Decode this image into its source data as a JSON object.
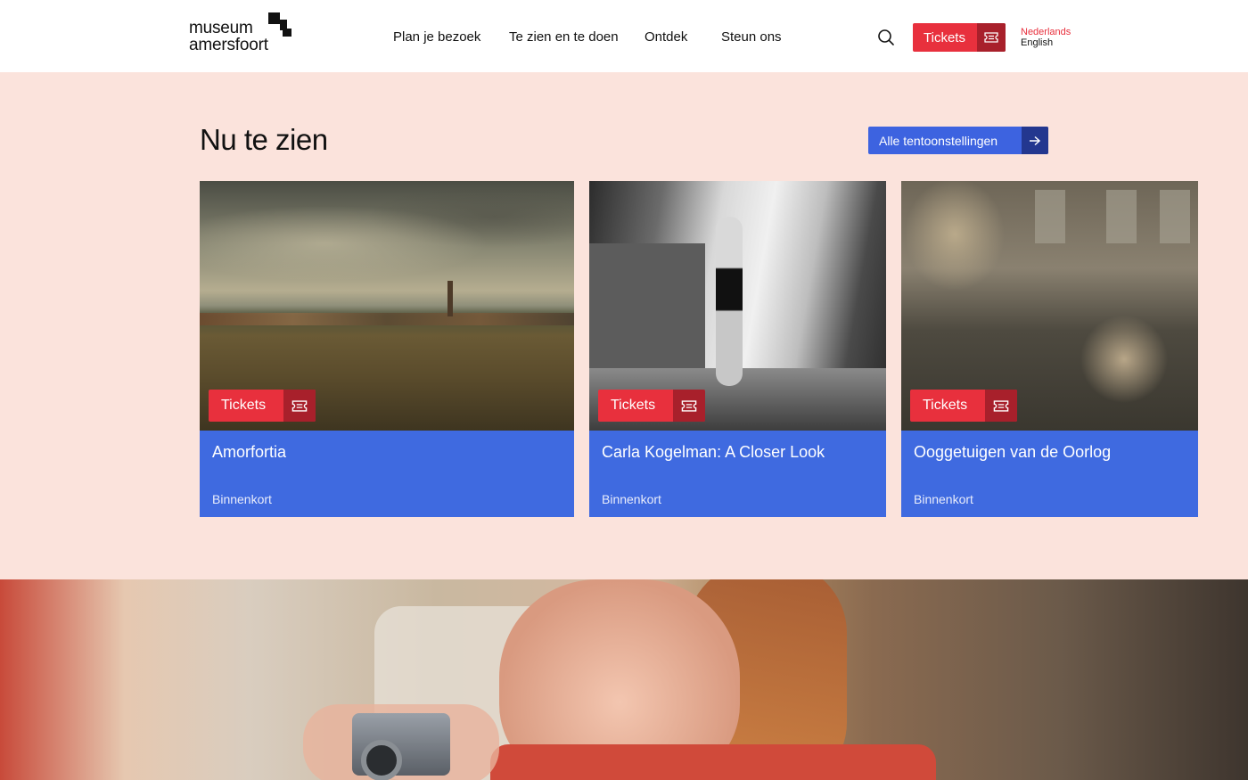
{
  "header": {
    "logo": {
      "line1": "museum",
      "line2": "amersfoort"
    },
    "nav": [
      {
        "label": "Plan je bezoek"
      },
      {
        "label": "Te zien en te doen"
      },
      {
        "label": "Ontdek"
      },
      {
        "label": "Steun ons"
      }
    ],
    "search_icon": "search-icon",
    "tickets_label": "Tickets",
    "ticket_icon": "ticket-icon",
    "languages": {
      "current": "Nederlands",
      "other": "English"
    }
  },
  "section": {
    "title": "Nu te zien",
    "all_button_label": "Alle tentoonstellingen",
    "all_button_icon": "arrow-right-icon"
  },
  "cards": [
    {
      "title": "Amorfortia",
      "status": "Binnenkort",
      "tickets_label": "Tickets"
    },
    {
      "title": "Carla Kogelman: A Closer Look",
      "status": "Binnenkort",
      "tickets_label": "Tickets"
    },
    {
      "title": "Ooggetuigen van de Oorlog",
      "status": "Binnenkort",
      "tickets_label": "Tickets"
    }
  ],
  "colors": {
    "page_bg": "#fbe3dc",
    "tickets_red": "#e8303d",
    "tickets_dark_red": "#a8202b",
    "card_blue": "#3f6ae0",
    "button_blue": "#3d63e0",
    "button_dark_blue": "#23378f"
  }
}
